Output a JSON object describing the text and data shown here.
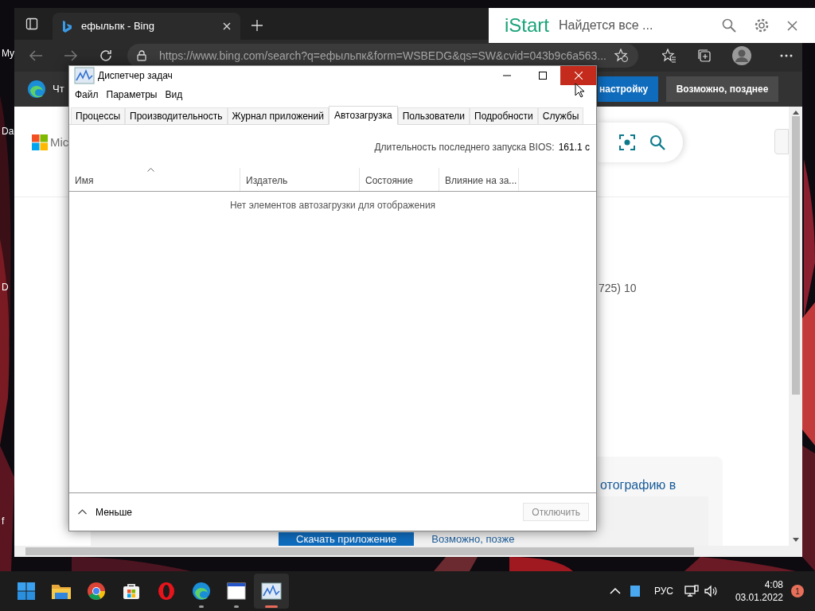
{
  "desktop": {
    "icon_labels": [
      "My",
      "Da",
      "D",
      "f"
    ]
  },
  "browser": {
    "tab": {
      "title": "ефыльпк - Bing"
    },
    "address": "https://www.bing.com/search?q=ефыльпк&form=WSBEDG&qs=SW&cvid=043b9c6a563...",
    "infobar": {
      "text": "Чт",
      "buttons": [
        {
          "label": "настройку",
          "kind": "primary"
        },
        {
          "label": "Возможно, позднее",
          "kind": "secondary"
        }
      ]
    },
    "page": {
      "logo_text": "Mic",
      "result_text": "725) 10",
      "card_text": "отографию в",
      "buttons": [
        {
          "label": "Скачать приложение",
          "kind": "primary"
        },
        {
          "label": "Возможно, позже",
          "kind": "link"
        }
      ]
    }
  },
  "istart": {
    "logo": "iStart",
    "text": "Найдется все ..."
  },
  "task_manager": {
    "title": "Диспетчер задач",
    "menu": [
      "Файл",
      "Параметры",
      "Вид"
    ],
    "tabs": [
      {
        "label": "Процессы",
        "selected": false
      },
      {
        "label": "Производительность",
        "selected": false
      },
      {
        "label": "Журнал приложений",
        "selected": false
      },
      {
        "label": "Автозагрузка",
        "selected": true
      },
      {
        "label": "Пользователи",
        "selected": false
      },
      {
        "label": "Подробности",
        "selected": false
      },
      {
        "label": "Службы",
        "selected": false
      }
    ],
    "bios": {
      "label": "Длительность последнего запуска BIOS:",
      "value": "161.1 с"
    },
    "columns": [
      {
        "label": "Имя",
        "sorted": true
      },
      {
        "label": "Издатель",
        "sorted": false
      },
      {
        "label": "Состояние",
        "sorted": false
      },
      {
        "label": "Влияние на за...",
        "sorted": false
      }
    ],
    "empty_message": "Нет элементов автозагрузки для отображения",
    "footer": {
      "less": "Меньше",
      "button": {
        "label": "Отключить",
        "disabled": true
      }
    }
  },
  "taskbar": {
    "apps": [
      {
        "kind": "start",
        "running": false,
        "selected": false
      },
      {
        "kind": "explorer",
        "running": false,
        "selected": false
      },
      {
        "kind": "chrome",
        "running": false,
        "selected": false
      },
      {
        "kind": "store",
        "running": false,
        "selected": false
      },
      {
        "kind": "opera",
        "running": false,
        "selected": false
      },
      {
        "kind": "edge",
        "running": true,
        "selected": false
      },
      {
        "kind": "window",
        "running": true,
        "selected": false
      },
      {
        "kind": "taskmgr",
        "running": true,
        "selected": true
      }
    ],
    "language": "РУС",
    "time": "4:08",
    "date": "03.01.2022",
    "notifications": "1"
  }
}
